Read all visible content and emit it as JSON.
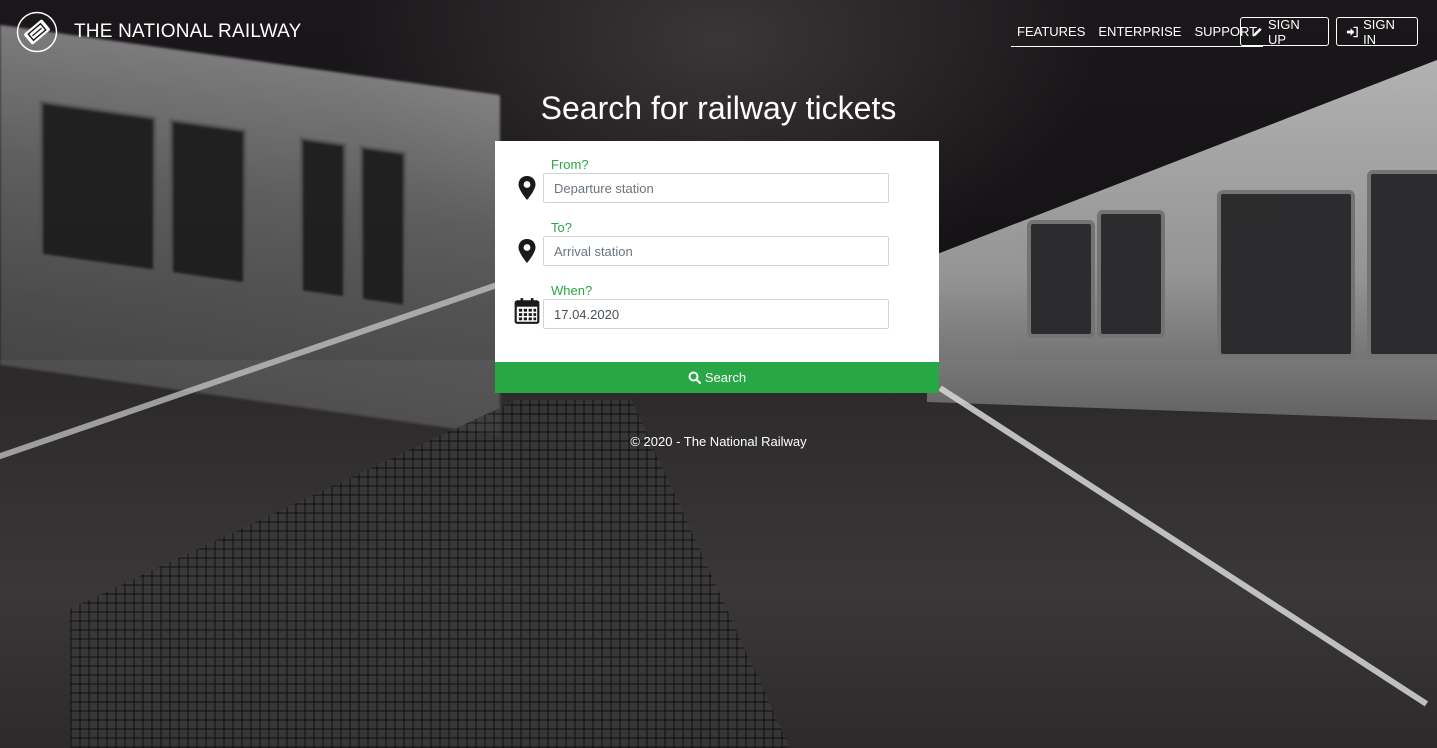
{
  "header": {
    "brand": "THE NATIONAL RAILWAY",
    "nav": [
      {
        "label": "FEATURES"
      },
      {
        "label": "ENTERPRISE"
      },
      {
        "label": "SUPPORT"
      }
    ],
    "signup_label": "SIGN UP",
    "signin_label": "SIGN IN"
  },
  "main": {
    "title": "Search for railway tickets",
    "from": {
      "label": "From?",
      "placeholder": "Departure station",
      "icon": "map-marker-icon"
    },
    "to": {
      "label": "To?",
      "placeholder": "Arrival station",
      "icon": "map-marker-icon"
    },
    "when": {
      "label": "When?",
      "value": "17.04.2020",
      "icon": "calendar-icon"
    },
    "search_label": "Search"
  },
  "footer": {
    "text": "© 2020 - The National Railway"
  },
  "colors": {
    "accent": "#28a745",
    "text_light": "#ffffff",
    "card": "#ffffff"
  }
}
